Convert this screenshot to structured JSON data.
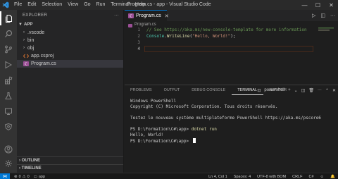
{
  "titlebar": {
    "menu": [
      "File",
      "Edit",
      "Selection",
      "View",
      "Go",
      "Run",
      "Terminal",
      "Help"
    ],
    "title": "Program.cs - app - Visual Studio Code"
  },
  "activitybar": {
    "icons": [
      "explorer-icon",
      "search-icon",
      "source-control-icon",
      "run-debug-icon",
      "extensions-icon",
      "testing-icon",
      "remote-explorer-icon",
      "docker-icon",
      "account-icon",
      "manage-gear-icon"
    ]
  },
  "sidebar": {
    "header": "EXPLORER",
    "root": "APP",
    "items": [
      {
        "label": ".vscode",
        "kind": "folder"
      },
      {
        "label": "bin",
        "kind": "folder"
      },
      {
        "label": "obj",
        "kind": "folder"
      },
      {
        "label": "app.csproj",
        "kind": "file"
      },
      {
        "label": "Program.cs",
        "kind": "file"
      }
    ],
    "outline": "OUTLINE",
    "timeline": "TIMELINE"
  },
  "editor": {
    "tab_label": "Program.cs",
    "breadcrumb": "Program.cs",
    "lines": [
      {
        "num": "1",
        "parts": [
          {
            "cls": "c-comment",
            "text": "// See https://aka.ms/new-console-template for more information"
          }
        ]
      },
      {
        "num": "2",
        "parts": [
          {
            "cls": "c-type",
            "text": "Console"
          },
          {
            "cls": "c-plain",
            "text": "."
          },
          {
            "cls": "c-method",
            "text": "WriteLine"
          },
          {
            "cls": "c-plain",
            "text": "("
          },
          {
            "cls": "c-str",
            "text": "\"Hello, World!\""
          },
          {
            "cls": "c-plain",
            "text": ");"
          }
        ]
      },
      {
        "num": "3",
        "parts": []
      },
      {
        "num": "4",
        "parts": []
      }
    ]
  },
  "panel": {
    "tabs": [
      "PROBLEMS",
      "OUTPUT",
      "DEBUG CONSOLE",
      "TERMINAL",
      "JUPYTER"
    ],
    "active_tab": "TERMINAL",
    "shell_label": "powershell",
    "terminal_lines": [
      {
        "type": "text",
        "text": "Windows PowerShell"
      },
      {
        "type": "text",
        "text": "Copyright (C) Microsoft Corporation. Tous droits réservés."
      },
      {
        "type": "blank",
        "text": ""
      },
      {
        "type": "text",
        "text": "Testez le nouveau système multiplateforme PowerShell https://aka.ms/pscore6"
      },
      {
        "type": "blank",
        "text": ""
      },
      {
        "type": "cmd",
        "prompt": "PS D:\\Formation\\C#\\app> ",
        "cmd": "dotnet run"
      },
      {
        "type": "text",
        "text": "Hello, World!"
      },
      {
        "type": "prompt",
        "prompt": "PS D:\\Formation\\C#\\app> "
      }
    ]
  },
  "statusbar": {
    "branch_label": "app",
    "errors": "0",
    "warnings": "0",
    "position": "Ln 4, Col 1",
    "spaces": "Spaces: 4",
    "encoding": "UTF-8 with BOM",
    "eol": "CRLF",
    "language": "C#"
  }
}
